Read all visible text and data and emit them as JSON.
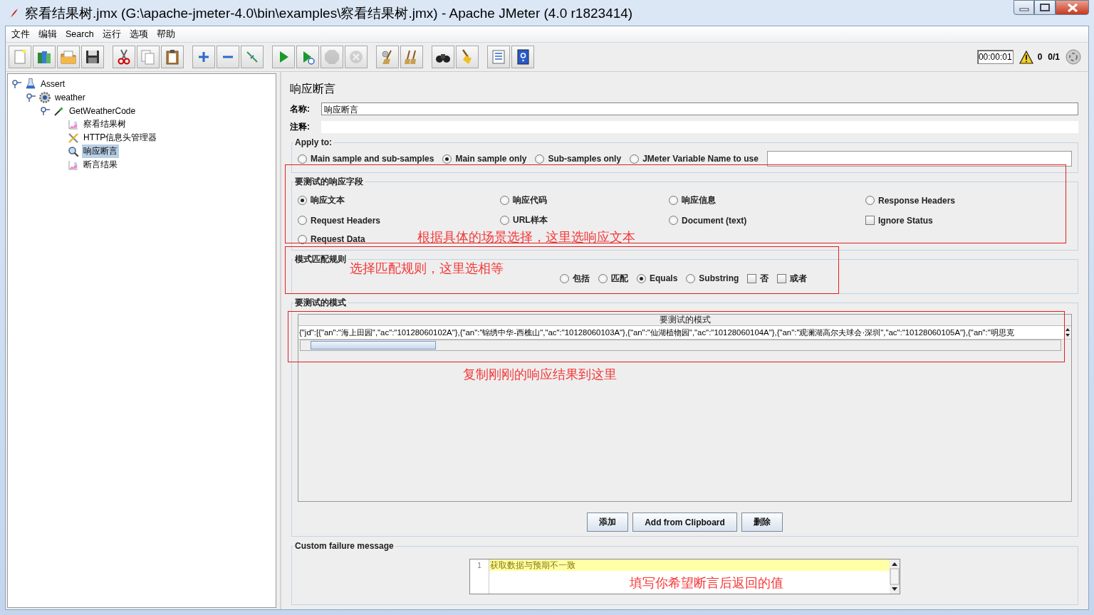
{
  "window": {
    "title": "察看结果树.jmx (G:\\apache-jmeter-4.0\\bin\\examples\\察看结果树.jmx) - Apache JMeter (4.0 r1823414)"
  },
  "menu": [
    "文件",
    "编辑",
    "Search",
    "运行",
    "选项",
    "帮助"
  ],
  "toolbar": {
    "groups": [
      {
        "buttons": [
          {
            "kind": "new",
            "disabled": false
          },
          {
            "kind": "templates",
            "disabled": false
          },
          {
            "kind": "open",
            "disabled": false
          },
          {
            "kind": "save",
            "disabled": false
          }
        ]
      },
      {
        "buttons": [
          {
            "kind": "cut",
            "disabled": false
          },
          {
            "kind": "copy",
            "disabled": false
          },
          {
            "kind": "paste",
            "disabled": false
          }
        ]
      },
      {
        "buttons": [
          {
            "kind": "expand",
            "disabled": false
          },
          {
            "kind": "collapse",
            "disabled": false
          },
          {
            "kind": "toggle",
            "disabled": false
          }
        ]
      },
      {
        "buttons": [
          {
            "kind": "start",
            "disabled": false
          },
          {
            "kind": "start_no_timers",
            "disabled": false
          },
          {
            "kind": "stop",
            "disabled": true
          },
          {
            "kind": "shutdown",
            "disabled": true
          }
        ]
      },
      {
        "buttons": [
          {
            "kind": "clear",
            "disabled": false
          },
          {
            "kind": "clear_all",
            "disabled": false
          }
        ]
      },
      {
        "buttons": [
          {
            "kind": "search",
            "disabled": false
          },
          {
            "kind": "reset_search",
            "disabled": false
          }
        ]
      },
      {
        "buttons": [
          {
            "kind": "function_helper",
            "disabled": false
          },
          {
            "kind": "help",
            "disabled": false
          }
        ]
      }
    ],
    "elapsed_time": "00:00:01",
    "warning_count": "0",
    "threads": "0/1"
  },
  "tree": [
    {
      "label": "Assert",
      "kind": "test_plan",
      "expanded": true,
      "selected": false,
      "children": [
        {
          "label": "weather",
          "kind": "thread_group",
          "expanded": true,
          "selected": false,
          "children": [
            {
              "label": "GetWeatherCode",
              "kind": "sampler",
              "expanded": true,
              "selected": false,
              "children": [
                {
                  "label": "察看结果树",
                  "kind": "listener",
                  "selected": false
                },
                {
                  "label": "HTTP信息头管理器",
                  "kind": "config",
                  "selected": false
                },
                {
                  "label": "响应断言",
                  "kind": "assertion",
                  "selected": true
                },
                {
                  "label": "断言结果",
                  "kind": "listener",
                  "selected": false
                }
              ]
            }
          ]
        }
      ]
    }
  ],
  "editor": {
    "title": "响应断言",
    "name_label": "名称:",
    "name_value": "响应断言",
    "comment_label": "注释:",
    "apply_to": {
      "legend": "Apply to:",
      "options": [
        {
          "label": "Main sample and sub-samples",
          "selected": false
        },
        {
          "label": "Main sample only",
          "selected": true
        },
        {
          "label": "Sub-samples only",
          "selected": false
        },
        {
          "label": "JMeter Variable Name to use",
          "selected": false
        }
      ]
    },
    "response_field": {
      "legend": "要测试的响应字段",
      "options": [
        {
          "kind": "radio",
          "label": "响应文本",
          "selected": true
        },
        {
          "kind": "radio",
          "label": "响应代码",
          "selected": false
        },
        {
          "kind": "radio",
          "label": "响应信息",
          "selected": false
        },
        {
          "kind": "radio",
          "label": "Response Headers",
          "selected": false
        },
        {
          "kind": "radio",
          "label": "Request Headers",
          "selected": false
        },
        {
          "kind": "radio",
          "label": "URL样本",
          "selected": false
        },
        {
          "kind": "radio",
          "label": "Document (text)",
          "selected": false
        },
        {
          "kind": "checkbox",
          "label": "Ignore Status",
          "checked": false
        },
        {
          "kind": "radio",
          "label": "Request Data",
          "selected": false
        }
      ]
    },
    "pattern_rule": {
      "legend": "模式匹配规则",
      "options": [
        {
          "kind": "radio",
          "label": "包括",
          "selected": false
        },
        {
          "kind": "radio",
          "label": "匹配",
          "selected": false
        },
        {
          "kind": "radio",
          "label": "Equals",
          "selected": true
        },
        {
          "kind": "radio",
          "label": "Substring",
          "selected": false
        },
        {
          "kind": "checkbox",
          "label": "否",
          "checked": false
        },
        {
          "kind": "checkbox",
          "label": "或者",
          "checked": false
        }
      ]
    },
    "patterns": {
      "legend": "要测试的模式",
      "column": "要测试的模式",
      "rows": [
        "{\"jd\":[{\"an\":\"海上田园\",\"ac\":\"10128060102A\"},{\"an\":\"锦绣中华-西樵山\",\"ac\":\"10128060103A\"},{\"an\":\"仙湖植物园\",\"ac\":\"10128060104A\"},{\"an\":\"观澜湖高尔夫球会·深圳\",\"ac\":\"10128060105A\"},{\"an\":\"明思克"
      ]
    },
    "buttons": [
      "添加",
      "Add from Clipboard",
      "删除"
    ],
    "failure": {
      "legend": "Custom failure message",
      "line_number": "1",
      "text": "获取数据与预期不一致"
    }
  },
  "annotations": [
    {
      "text": "根据具体的场景选择，这里选响应文本"
    },
    {
      "text": "选择匹配规则，这里选相等"
    },
    {
      "text": "复制刚刚的响应结果到这里"
    },
    {
      "text": "填写你希望断言后返回的值"
    }
  ]
}
